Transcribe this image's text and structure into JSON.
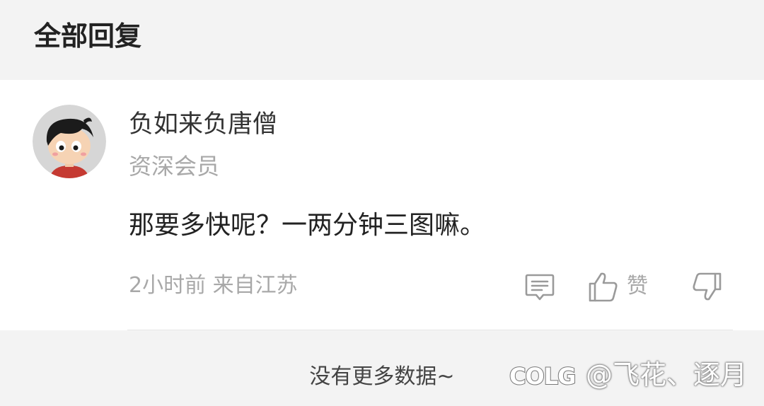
{
  "header": {
    "title": "全部回复"
  },
  "reply": {
    "username": "负如来负唐僧",
    "member_level": "资深会员",
    "content": "那要多快呢？一两分钟三图嘛。",
    "time": "2小时前",
    "location": "来自江苏",
    "meta_text": "2小时前 来自江苏",
    "actions": {
      "reply_icon": "comment-icon",
      "like_icon": "thumbs-up-icon",
      "like_label": "赞",
      "dislike_icon": "thumbs-down-icon"
    }
  },
  "footer": {
    "no_more": "没有更多数据~"
  },
  "watermark": {
    "logo_text": "COLG",
    "text": "@飞花、逐月"
  },
  "colors": {
    "background": "#f3f3f3",
    "card": "#ffffff",
    "muted_text": "#a8a8a8",
    "primary_text": "#222222"
  }
}
